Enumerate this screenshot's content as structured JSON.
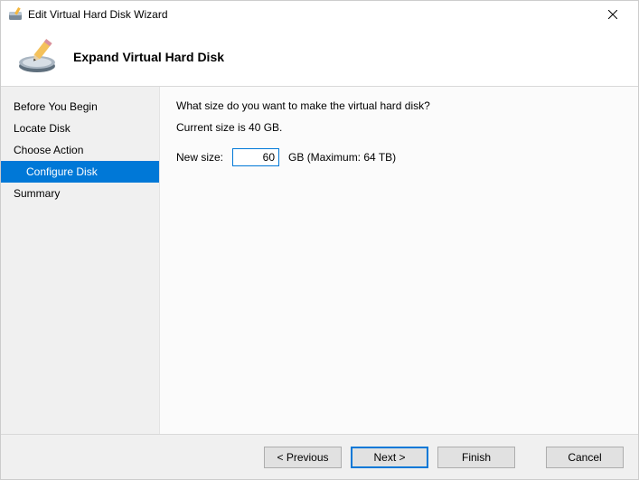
{
  "window": {
    "title": "Edit Virtual Hard Disk Wizard"
  },
  "header": {
    "title": "Expand Virtual Hard Disk"
  },
  "sidebar": {
    "steps": [
      {
        "label": "Before You Begin",
        "active": false
      },
      {
        "label": "Locate Disk",
        "active": false
      },
      {
        "label": "Choose Action",
        "active": false
      },
      {
        "label": "Configure Disk",
        "active": true
      },
      {
        "label": "Summary",
        "active": false
      }
    ]
  },
  "main": {
    "prompt": "What size do you want to make the virtual hard disk?",
    "current_size_text": "Current size is 40 GB.",
    "new_size_label": "New size:",
    "new_size_value": "60",
    "new_size_suffix": "GB (Maximum: 64 TB)"
  },
  "footer": {
    "previous": "< Previous",
    "next": "Next >",
    "finish": "Finish",
    "cancel": "Cancel"
  }
}
